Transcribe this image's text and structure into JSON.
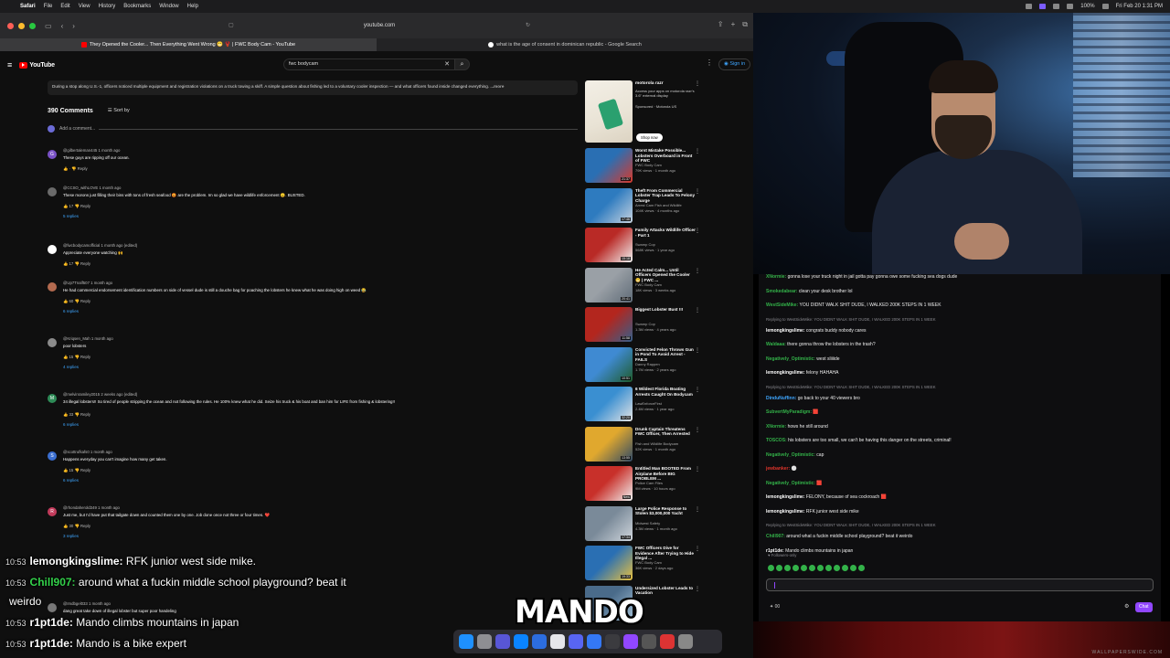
{
  "menubar": {
    "app": "Safari",
    "items": [
      "File",
      "Edit",
      "View",
      "History",
      "Bookmarks",
      "Window",
      "Help"
    ],
    "battery": "100%",
    "datetime": "Fri Feb 20 1:31 PM"
  },
  "browser": {
    "address": "youtube.com",
    "tabs": [
      {
        "label": "They Opened the Cooler... Then Everything Went Wrong 😬 🦞 | FWC Body Cam - YouTube",
        "active": true
      },
      {
        "label": "what is the age of consent in dominican republic - Google Search",
        "active": false
      }
    ]
  },
  "youtube": {
    "logo": "YouTube",
    "search_value": "fwc bodycam",
    "sign_in": "Sign in",
    "description": "During a stop along U.S.-1, officers noticed multiple equipment and registration violations on a truck towing a skiff. A simple question about fishing led to a voluntary cooler inspection — and what officers found inside changed everything.",
    "more": "...more",
    "comment_count": "390 Comments",
    "sort_by": "Sort by",
    "add_comment": "Add a comment...",
    "comments": [
      {
        "avatar": "G",
        "color": "#7a52c7",
        "meta": "@gilbertaleman445  1 month ago",
        "text": "These guys are ripping off our ocean.",
        "likes": "👍 ⋅ 👎  Reply",
        "replies": ""
      },
      {
        "avatar": "",
        "color": "#6a6a6a",
        "meta": "@CCSO_withLOVE  1 month ago",
        "text": "These morons just filling their bins with tons of fresh seafood 😡 are the problem. Im so glad we have wildlife enforcement 😠. BUSTED.",
        "likes": "👍 17  👎  Reply",
        "replies": "5 replies"
      },
      {
        "avatar": "",
        "color": "#ffffff",
        "meta": "@fwcbodycamofficial  1 month ago (edited)",
        "text": "Appreciate everyone watching 🙌",
        "likes": "👍 17  👎  Reply",
        "replies": ""
      },
      {
        "avatar": "",
        "color": "#b36a4f",
        "meta": "@Up7Tnalf507  1 month ago",
        "text": "He had commercial endorsement identification numbers on side of vessel dude is still a douche bag for poaching the lobsters he knew what he was doing high on weed 😂",
        "likes": "👍 60  👎  Reply",
        "replies": "6 replies"
      },
      {
        "avatar": "",
        "color": "#8b8b8b",
        "meta": "@Kriqsen_Mah  1 month ago",
        "text": "poor lobsters",
        "likes": "👍 15  👎  Reply",
        "replies": "4 replies"
      },
      {
        "avatar": "M",
        "color": "#2e8b57",
        "meta": "@melvinramiley2015  2 weeks ago (edited)",
        "text": "34 illegal lobsters!! So tired of people stripping the ocean and not following the rules. He 100% knew what he did. Seize his truck & his boat and ban him for LIFE from fishing & lobstering!!",
        "likes": "👍 33  👎  Reply",
        "replies": "6 replies"
      },
      {
        "avatar": "S",
        "color": "#3b6fd1",
        "meta": "@scottrufkafs0  1 month ago",
        "text": "Happens everyday you can't imagine how many get taken.",
        "likes": "👍 15  👎  Reply",
        "replies": "6 replies"
      },
      {
        "avatar": "R",
        "color": "#c23b5b",
        "meta": "@rhondaherold349  1 month ago",
        "text": "Just me, but I'd have put that tailgate down and counted them one by one. Job done once not three or four times. ❤️",
        "likes": "👍 30  👎  Reply",
        "replies": "3 replies"
      },
      {
        "avatar": "",
        "color": "#777777",
        "meta": "@Imdbgel033  1 month ago",
        "text": "dang great take down of illegal lobster but super poor handeling",
        "likes": "",
        "replies": ""
      }
    ],
    "ad": {
      "title": "motorola razr",
      "desc": "Access your apps on motorola razr's 3.6\" external display",
      "sponsor": "Sponsored · Motorola US",
      "cta": "Shop now"
    },
    "recommendations": [
      {
        "title": "Worst Mistake Possible... Lobsters Overboard in Front of FWC",
        "channel": "FWC Body Cam",
        "views": "79K views · 1 month ago",
        "duration": "21:37",
        "colors": [
          "#2a6fb3",
          "#d7392c"
        ]
      },
      {
        "title": "Theft From Commercial Lobster Trap Leads To Felony Charge",
        "channel": "Arrest Cam Fish and Wildlife",
        "views": "104K views · 4 months ago",
        "duration": "17:46",
        "colors": [
          "#2e7bbf",
          "#c7d4e0"
        ]
      },
      {
        "title": "Family Attacks Wildlife Officer - Part 1",
        "channel": "Swamp Cop",
        "views": "568K views · 1 year ago",
        "duration": "15:18",
        "colors": [
          "#b92a26",
          "#f2f2f2"
        ]
      },
      {
        "title": "He Acted Calm... Until Officers Opened the Cooler 😬 | FWC ...",
        "channel": "FWC Body Cam",
        "views": "18K views · 3 weeks ago",
        "duration": "20:41",
        "colors": [
          "#9aa0a6",
          "#5f6b77"
        ]
      },
      {
        "title": "Biggest Lobster Bust !!!",
        "channel": "Swamp Cop",
        "views": "1.3M views · 4 years ago",
        "duration": "11:58",
        "colors": [
          "#b3261e",
          "#355f8a"
        ]
      },
      {
        "title": "Convicted Felon Throws Gun in Pond To Avoid Arrest - FAILS",
        "channel": "Danny Rappen",
        "views": "1.7M views · 2 years ago",
        "duration": "10:51",
        "colors": [
          "#3f8ad2",
          "#1f5b2c"
        ]
      },
      {
        "title": "6 Wildest Florida Boating Arrests Caught On Bodycam",
        "channel": "LawEnforceFirst",
        "views": "2.4M views · 1 year ago",
        "duration": "32:20",
        "colors": [
          "#3a8fd1",
          "#e5e5e5"
        ]
      },
      {
        "title": "Drunk Captain Threatens FWC Officer, Then Arrested",
        "channel": "Fish and Wildlife Bodycam",
        "views": "52K views · 1 month ago",
        "duration": "13:55",
        "colors": [
          "#e0a82e",
          "#304a66"
        ]
      },
      {
        "title": "Entitled Man BOOTED From Airplane Before BIG PROBLEM ...",
        "channel": "Police Cam Files",
        "views": "9M views · 10 hours ago",
        "duration": "New",
        "colors": [
          "#c8302a",
          "#f1f1f1"
        ]
      },
      {
        "title": "Large Police Response to Stolen $3,000,000 Yacht",
        "channel": "Midwest Safety",
        "views": "4.3M views · 1 month ago",
        "duration": "17:34",
        "colors": [
          "#7a8a99",
          "#d0d6dc"
        ]
      },
      {
        "title": "FWC Officers Dive for Evidence After Trying to Hide Illegal ...",
        "channel": "FWC Body Cam",
        "views": "36K views · 2 days ago",
        "duration": "19:33",
        "colors": [
          "#2a6fb3",
          "#e8c140"
        ]
      },
      {
        "title": "Undersized Lobster Leads to Vacation",
        "channel": "",
        "views": "",
        "duration": "",
        "colors": [
          "#4a6b8a",
          "#a3c0d6"
        ]
      }
    ]
  },
  "stream_chat": {
    "lines": [
      {
        "user": "XNormie:",
        "color": "#33b249",
        "text": "gonna lose your truck night in jail gotta pay gonna owe some fucking sea dogs dude",
        "reply": false
      },
      {
        "user": "Smokedabear:",
        "color": "#33b249",
        "text": "clean your desk brother lol",
        "reply": false
      },
      {
        "user": "WestSideMike:",
        "color": "#33b249",
        "text": "YOU DIDNT WALK SHIT DUDE, I WALKED 200K STEPS IN 1 WEEK",
        "reply": false
      },
      {
        "user": "",
        "color": "",
        "text": "Replying to WestSideMike: YOU DIDNT WALK SHIT DUDE, I WALKED 200K STEPS IN 1 WEEK",
        "reply": true
      },
      {
        "user": "lemongkingslime:",
        "color": "#ffffff",
        "text": "congrats buddy nobody cares",
        "reply": false
      },
      {
        "user": "Waldaaa:",
        "color": "#33b249",
        "text": "there gonna throw the lobsters in the trash?",
        "reply": false
      },
      {
        "user": "Negatively_Optimistic:",
        "color": "#33b249",
        "text": "west sliiiide",
        "reply": false
      },
      {
        "user": "lemongkingslime:",
        "color": "#ffffff",
        "text": "felony HAHAHA",
        "reply": false
      },
      {
        "user": "",
        "color": "",
        "text": "Replying to WestSideMike: YOU DIDNT WALK SHIT DUDE, I WALKED 200K STEPS IN 1 WEEK",
        "reply": true
      },
      {
        "user": "DinduNuffinn:",
        "color": "#3ea6ff",
        "text": "go back to your 40 viewers bro",
        "reply": false
      },
      {
        "user": "SubvertMyParadigm:",
        "color": "#33b249",
        "text": "🟥",
        "reply": false
      },
      {
        "user": "XNormie:",
        "color": "#33b249",
        "text": "hows he still around",
        "reply": false
      },
      {
        "user": "TOSCOS:",
        "color": "#33b249",
        "text": "his lobsters are too small, we can't be having this danger on the streets, criminal!",
        "reply": false
      },
      {
        "user": "Negatively_Optimistic:",
        "color": "#33b249",
        "text": "cap",
        "reply": false
      },
      {
        "user": "jewbanker:",
        "color": "#e0352b",
        "text": "⚪",
        "reply": false
      },
      {
        "user": "Negatively_Optimistic:",
        "color": "#33b249",
        "text": "🟥",
        "reply": false
      },
      {
        "user": "lemongkingslime:",
        "color": "#ffffff",
        "text": "FELONY, because of sea cockroach 🟥",
        "reply": false
      },
      {
        "user": "lemongkingslime:",
        "color": "#ffffff",
        "text": "RFK junior west side mike",
        "reply": false
      },
      {
        "user": "",
        "color": "",
        "text": "Replying to WestSideMike: YOU DIDNT WALK SHIT DUDE, I WALKED 200K STEPS IN 1 WEEK",
        "reply": true
      },
      {
        "user": "Chill907:",
        "color": "#33b249",
        "text": "around what a fuckin middle school playground? beat it weirdo",
        "reply": false
      },
      {
        "user": "r1pt1de:",
        "color": "#ffffff",
        "text": "Mando climbs mountains in japan",
        "reply": false
      }
    ],
    "followers_only": "Followers-only",
    "points": "00",
    "send": "Chat"
  },
  "overlay": {
    "lines": [
      {
        "time": "10:53",
        "user": "lemongkingslime:",
        "color": "#ffffff",
        "text": "RFK junior west side mike."
      },
      {
        "time": "10:53",
        "user": "Chill907:",
        "color": "#33d14a",
        "text": "around what a fuckin middle school playground? beat it"
      },
      {
        "time": "",
        "user": "",
        "color": "#ffffff",
        "text": "weirdo"
      },
      {
        "time": "10:53",
        "user": "r1pt1de:",
        "color": "#ffffff",
        "text": "Mando climbs mountains in japan"
      },
      {
        "time": "10:53",
        "user": "r1pt1de:",
        "color": "#ffffff",
        "text": "Mando is a bike expert"
      }
    ],
    "logo": "MANDO"
  },
  "watermark": "WALLPAPERSWIDE.COM"
}
